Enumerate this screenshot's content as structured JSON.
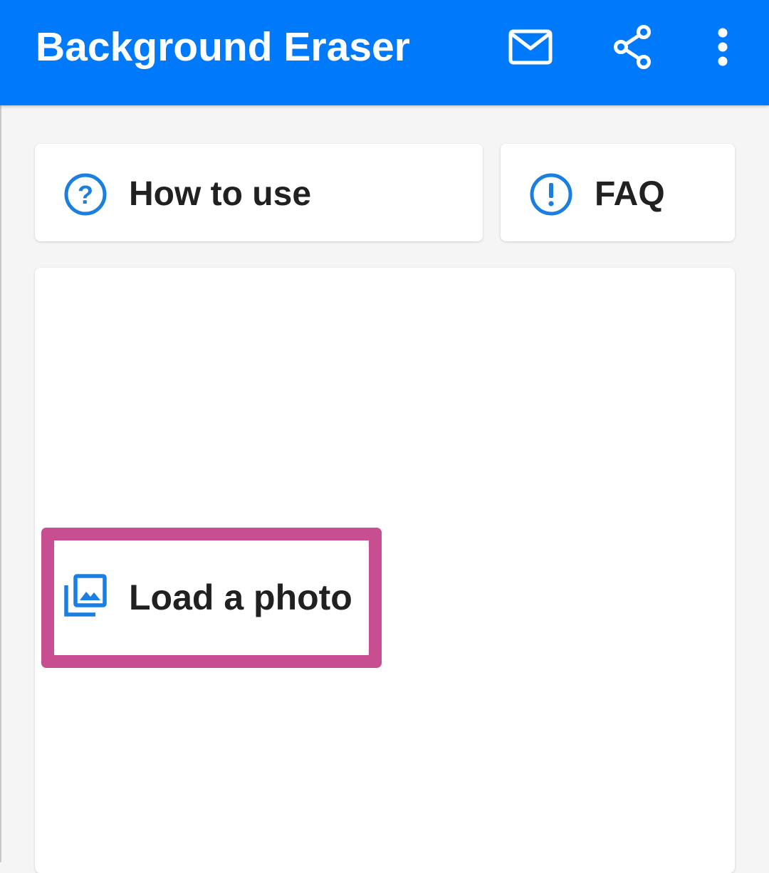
{
  "app_bar": {
    "title": "Background Eraser",
    "background_color": "#0079fb",
    "actions": [
      {
        "name": "mail",
        "icon": "mail-icon"
      },
      {
        "name": "share",
        "icon": "share-icon"
      },
      {
        "name": "more",
        "icon": "more-vert-icon"
      }
    ]
  },
  "cards": {
    "how_to_use": {
      "label": "How to use",
      "icon": "help-circle-icon"
    },
    "faq": {
      "label": "FAQ",
      "icon": "info-circle-icon"
    }
  },
  "main": {
    "load_photo": {
      "label": "Load a photo",
      "icon": "photo-library-icon",
      "highlighted": true
    }
  },
  "colors": {
    "accent": "#0079fb",
    "icon_blue": "#1a7fe0",
    "highlight": "#c74e90",
    "text": "#212121",
    "background": "#f5f5f5"
  }
}
